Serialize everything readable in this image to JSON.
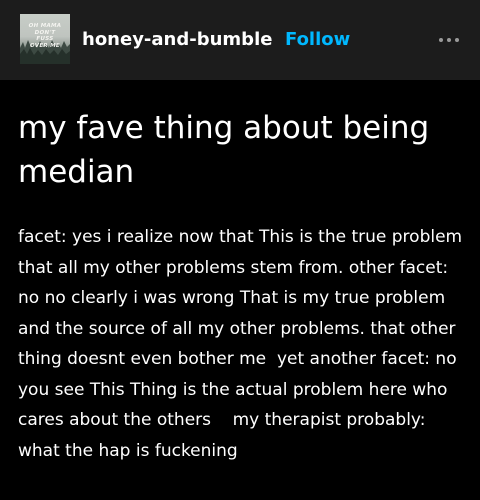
{
  "header": {
    "avatar_text": "OH MAMA\nDON'T\nFUSS\nOVER ME",
    "blog_name": "honey-and-bumble",
    "follow_label": "Follow",
    "more_icon": "more-horizontal-icon"
  },
  "post": {
    "title": "my fave thing about being median",
    "body": "facet: yes i realize now that This is the true problem that all my other problems stem from. other facet: no no clearly i was wrong That is my true problem and the source of all my other problems. that other thing doesnt even bother me  yet another facet: no you see This Thing is the actual problem here who cares about the others    my therapist probably: what the hap is fuckening"
  },
  "colors": {
    "background": "#000000",
    "header_background": "#1c1c1c",
    "accent": "#00b8ff",
    "text": "#ffffff"
  }
}
